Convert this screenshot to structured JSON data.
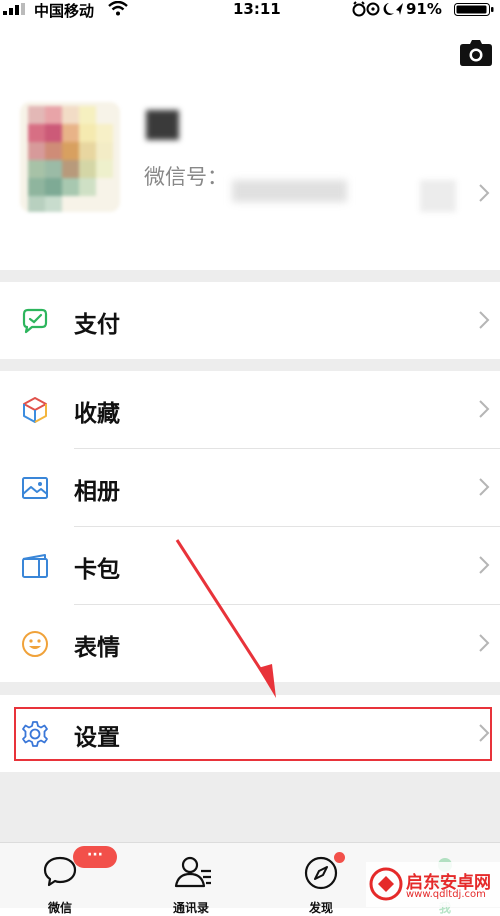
{
  "status_bar": {
    "carrier": "中国移动",
    "time": "13:11",
    "battery": "91%"
  },
  "profile": {
    "wechat_id_label": "微信号："
  },
  "menu": {
    "pay": "支付",
    "favorites": "收藏",
    "album": "相册",
    "cards": "卡包",
    "stickers": "表情",
    "settings": "设置"
  },
  "tabs": {
    "chats": "微信",
    "contacts": "通讯录",
    "discover": "发现",
    "me": "我",
    "chats_badge": "···"
  },
  "watermark": {
    "name": "启东安卓网",
    "url": "www.qdltdj.com"
  },
  "colors": {
    "pay_green": "#2db55d",
    "highlight_red": "#e8333a",
    "settings_blue": "#3a77d8",
    "badge_red": "#f2504a"
  }
}
